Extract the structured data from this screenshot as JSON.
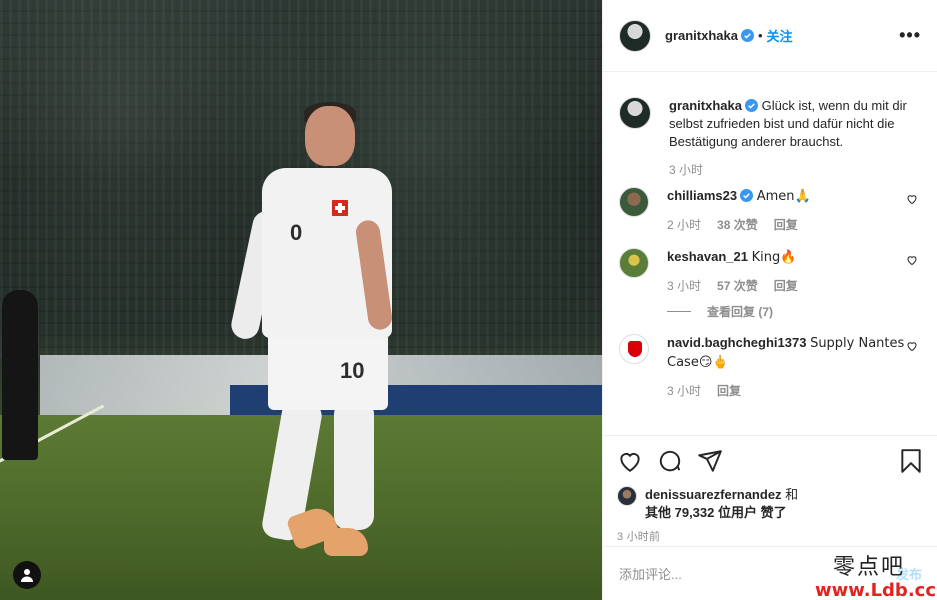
{
  "colors": {
    "link_blue": "#0095f6",
    "muted": "#8e8e8e",
    "watermark_red": "#e3231f"
  },
  "post": {
    "username": "granitxhaka",
    "verified": true,
    "separator": "•",
    "follow_label": "关注",
    "more_icon": "more-options-icon",
    "player_numbers": {
      "chest": "0",
      "shorts": "10"
    }
  },
  "caption": {
    "username": "granitxhaka",
    "text": "Glück ist, wenn du mit dir selbst zufrieden bist und dafür nicht die Bestätigung anderer brauchst.",
    "time": "3 小时"
  },
  "comments": [
    {
      "username": "chilliams23",
      "verified": true,
      "text": "Amen🙏",
      "time": "2 小时",
      "likes": "38 次赞",
      "reply": "回复"
    },
    {
      "username": "keshavan_21",
      "verified": false,
      "text": "King🔥",
      "time": "3 小时",
      "likes": "57 次赞",
      "reply": "回复",
      "view_replies": "查看回复 (7)"
    },
    {
      "username": "navid.baghcheghi1373",
      "verified": false,
      "text": "Supply Nantes Case😏🖕",
      "time": "3 小时",
      "reply": "回复"
    }
  ],
  "actions": {
    "like": "heart-icon",
    "comment": "comment-icon",
    "share": "share-icon",
    "save": "bookmark-icon"
  },
  "likes": {
    "first_user": "denissuarezfernandez",
    "and": "和",
    "others": "其他 79,332 位用户",
    "suffix": "赞了"
  },
  "post_time": "3 小时前",
  "add_comment": {
    "placeholder": "添加评论...",
    "post_label": "发布"
  },
  "watermark": {
    "cn": "零点吧",
    "url": "www.Ldb.cc"
  }
}
